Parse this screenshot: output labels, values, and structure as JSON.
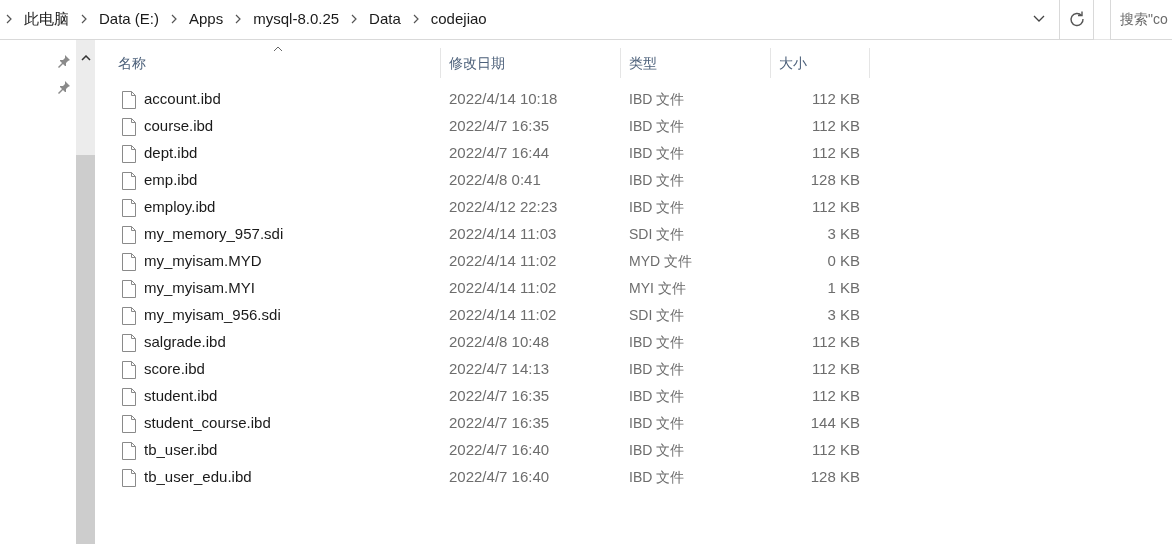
{
  "breadcrumb": [
    "此电脑",
    "Data (E:)",
    "Apps",
    "mysql-8.0.25",
    "Data",
    "codejiao"
  ],
  "search": {
    "placeholder": "搜索\"co"
  },
  "columns": [
    "名称",
    "修改日期",
    "类型",
    "大小"
  ],
  "files": [
    {
      "name": "account.ibd",
      "modified": "2022/4/14 10:18",
      "type": "IBD 文件",
      "size": "112 KB"
    },
    {
      "name": "course.ibd",
      "modified": "2022/4/7 16:35",
      "type": "IBD 文件",
      "size": "112 KB"
    },
    {
      "name": "dept.ibd",
      "modified": "2022/4/7 16:44",
      "type": "IBD 文件",
      "size": "112 KB"
    },
    {
      "name": "emp.ibd",
      "modified": "2022/4/8 0:41",
      "type": "IBD 文件",
      "size": "128 KB"
    },
    {
      "name": "employ.ibd",
      "modified": "2022/4/12 22:23",
      "type": "IBD 文件",
      "size": "112 KB"
    },
    {
      "name": "my_memory_957.sdi",
      "modified": "2022/4/14 11:03",
      "type": "SDI 文件",
      "size": "3 KB"
    },
    {
      "name": "my_myisam.MYD",
      "modified": "2022/4/14 11:02",
      "type": "MYD 文件",
      "size": "0 KB"
    },
    {
      "name": "my_myisam.MYI",
      "modified": "2022/4/14 11:02",
      "type": "MYI 文件",
      "size": "1 KB"
    },
    {
      "name": "my_myisam_956.sdi",
      "modified": "2022/4/14 11:02",
      "type": "SDI 文件",
      "size": "3 KB"
    },
    {
      "name": "salgrade.ibd",
      "modified": "2022/4/8 10:48",
      "type": "IBD 文件",
      "size": "112 KB"
    },
    {
      "name": "score.ibd",
      "modified": "2022/4/7 14:13",
      "type": "IBD 文件",
      "size": "112 KB"
    },
    {
      "name": "student.ibd",
      "modified": "2022/4/7 16:35",
      "type": "IBD 文件",
      "size": "112 KB"
    },
    {
      "name": "student_course.ibd",
      "modified": "2022/4/7 16:35",
      "type": "IBD 文件",
      "size": "144 KB"
    },
    {
      "name": "tb_user.ibd",
      "modified": "2022/4/7 16:40",
      "type": "IBD 文件",
      "size": "112 KB"
    },
    {
      "name": "tb_user_edu.ibd",
      "modified": "2022/4/7 16:40",
      "type": "IBD 文件",
      "size": "128 KB"
    }
  ]
}
